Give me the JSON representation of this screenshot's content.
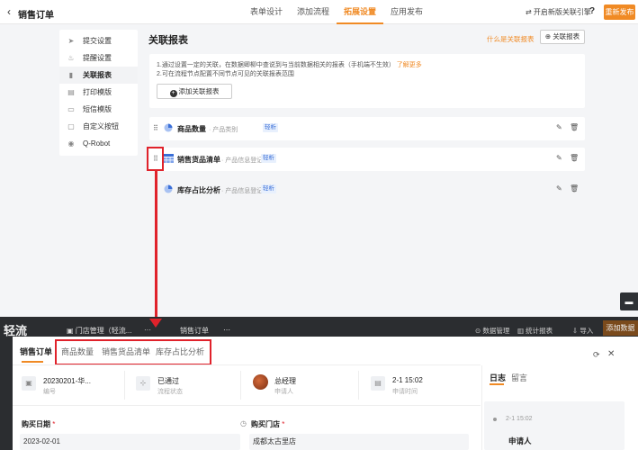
{
  "header": {
    "back_icon": "chevron-left-icon",
    "title": "销售订单",
    "tabs": [
      {
        "label": "表单设计",
        "active": false
      },
      {
        "label": "添加流程",
        "active": false
      },
      {
        "label": "拓展设置",
        "active": true
      },
      {
        "label": "应用发布",
        "active": false
      }
    ],
    "new_version_label": "⇄ 开启新版关联引擎",
    "help_label": "?",
    "publish_label": "重新发布",
    "accent_color": "#f08a24"
  },
  "sidebar": {
    "items": [
      {
        "icon": "send-icon",
        "glyph": "➤",
        "label": "提交设置",
        "active": false
      },
      {
        "icon": "bell-icon",
        "glyph": "🔔",
        "label": "提醒设置",
        "active": false
      },
      {
        "icon": "link-icon",
        "glyph": "▮",
        "label": "关联报表",
        "active": true
      },
      {
        "icon": "printer-icon",
        "glyph": "▤",
        "label": "打印模版",
        "active": false
      },
      {
        "icon": "sms-icon",
        "glyph": "▭",
        "label": "短信模版",
        "active": false
      },
      {
        "icon": "button-icon",
        "glyph": "▢",
        "label": "自定义按钮",
        "active": false
      },
      {
        "icon": "robot-icon",
        "glyph": "◉",
        "label": "Q-Robot",
        "active": false
      }
    ]
  },
  "main": {
    "title": "关联报表",
    "help_link": "什么是关联报表",
    "add_top_label": "关联报表",
    "desc_line1": "1.通过设置一定的关联，在数据卿柳中查说到与当前数据相关的报表（手机端不生效）",
    "learn_more": "了解更多",
    "desc_line2": "2.可在流程节点配置不同节点可见的关联报表范围",
    "add_button_label": "添加关联报表",
    "reports": [
      {
        "icon": "pie-chart-icon",
        "name": "商品数量",
        "source": "· 产品类别",
        "tag": "轻析"
      },
      {
        "icon": "table-icon",
        "name": "销售货品清单",
        "source": "· 产品信息登记",
        "tag": "轻析"
      },
      {
        "icon": "pie-chart-icon",
        "name": "库存占比分析",
        "source": "· 产品信息登记",
        "tag": "轻析"
      }
    ]
  },
  "chat_icon": "chat-icon",
  "background_app": {
    "brand": "轻流",
    "app_name": "门店管理（轻流...",
    "more": "··· ",
    "form_name": "销售订单",
    "share": "⋯",
    "data_mgmt": "数据管理",
    "stats": "统计报表",
    "import": "导入",
    "add_data": "添加数据"
  },
  "drawer": {
    "tabs": [
      "销售订单",
      "商品数量",
      "销售货品清单",
      "库存占比分析"
    ],
    "info": [
      {
        "icon": "id-icon",
        "glyph": "▣",
        "value": "20230201-华...",
        "key": "编号"
      },
      {
        "icon": "flow-icon",
        "glyph": "⊹",
        "value": "已通过",
        "key": "流程状态"
      },
      {
        "icon": "avatar",
        "glyph": "",
        "value": "总经理",
        "key": "申请人"
      },
      {
        "icon": "calendar-icon",
        "glyph": "▤",
        "value": "2-1 15:02",
        "key": "申请时间"
      }
    ],
    "fields": [
      {
        "label": "购买日期",
        "value": "2023-02-01"
      },
      {
        "label": "购买门店",
        "value": "成都太古里店"
      }
    ],
    "log_tabs": [
      "日志",
      "留言"
    ],
    "log_time": "2-1 15:02",
    "log_name": "申请人"
  }
}
